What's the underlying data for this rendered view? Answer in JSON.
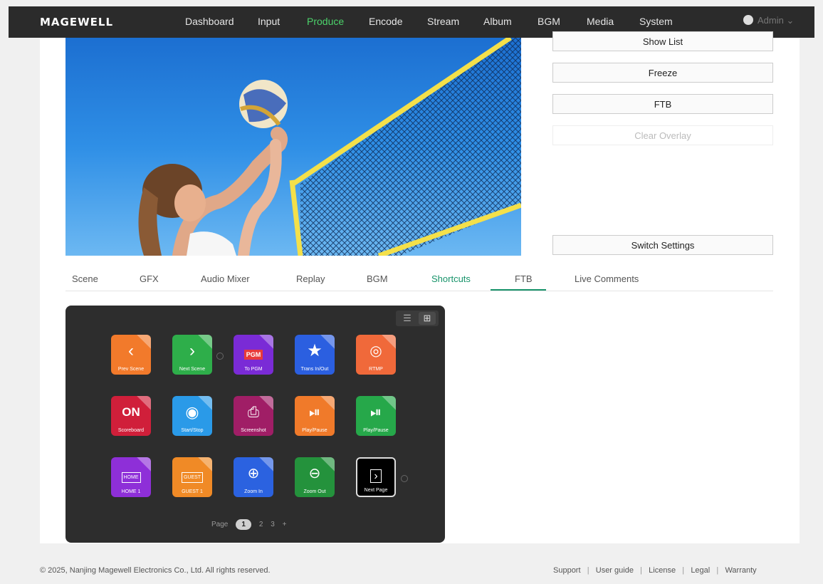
{
  "brand": "MAGEWELL",
  "nav": {
    "items": [
      "Dashboard",
      "Input",
      "Produce",
      "Encode",
      "Stream",
      "Album",
      "BGM",
      "Media",
      "System"
    ],
    "active": "Produce",
    "user": "Admin"
  },
  "controls": {
    "show_list": "Show List",
    "freeze": "Freeze",
    "ftb": "FTB",
    "clear_overlay": "Clear Overlay",
    "switch_settings": "Switch Settings"
  },
  "tabs": [
    "Scene",
    "GFX",
    "Audio Mixer",
    "Replay",
    "BGM",
    "Shortcuts",
    "FTB",
    "Live Comments"
  ],
  "active_tab": "Shortcuts",
  "shortcuts": [
    {
      "label": "Prev Scene",
      "color": "#f27a2b",
      "icon": "chevron-left-icon"
    },
    {
      "label": "Next Scene",
      "color": "#2eae4a",
      "icon": "chevron-right-icon"
    },
    {
      "label": "To PGM",
      "color": "#7a2bd6",
      "icon": "pgm-icon",
      "icon_text": "PGM"
    },
    {
      "label": "Trans In/Out",
      "color": "#2b5fe0",
      "icon": "star-icon"
    },
    {
      "label": "RTMP",
      "color": "#f0693a",
      "icon": "broadcast-icon"
    },
    {
      "label": "Scoreboard",
      "color": "#d01f3a",
      "icon": "on-icon",
      "icon_text": "ON"
    },
    {
      "label": "Start/Stop",
      "color": "#2a9ae8",
      "icon": "record-icon"
    },
    {
      "label": "Screenshot",
      "color": "#a01e66",
      "icon": "camera-icon"
    },
    {
      "label": "Play/Pause",
      "color": "#f07a2a",
      "icon": "play-pause-icon"
    },
    {
      "label": "Play/Pause",
      "color": "#26a84a",
      "icon": "play-pause-icon"
    },
    {
      "label": "HOME 1",
      "color": "#8e2fd8",
      "icon": "home-icon",
      "icon_text": "HOME"
    },
    {
      "label": "GUEST 1",
      "color": "#f08a26",
      "icon": "guest-icon",
      "icon_text": "GUEST"
    },
    {
      "label": "Zoom In",
      "color": "#2b62e0",
      "icon": "zoom-in-icon"
    },
    {
      "label": "Zoom Out",
      "color": "#24923c",
      "icon": "zoom-out-icon"
    },
    {
      "label": "Next Page",
      "color": "#000000",
      "icon": "next-page-icon"
    }
  ],
  "pager": {
    "label": "Page",
    "pages": [
      "1",
      "2",
      "3"
    ],
    "current": "1",
    "add": "+"
  },
  "footer": {
    "copyright": "© 2025, Nanjing Magewell Electronics Co., Ltd. All rights reserved.",
    "links": [
      "Support",
      "User guide",
      "License",
      "Legal",
      "Warranty"
    ]
  }
}
